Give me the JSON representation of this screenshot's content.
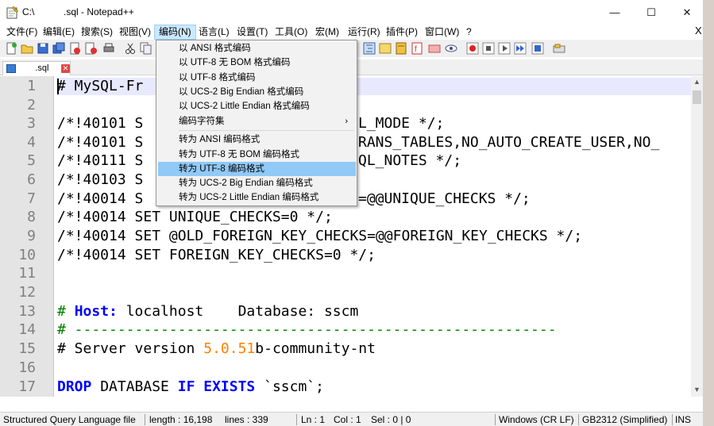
{
  "window": {
    "title": "C:\\           .sql - Notepad++",
    "minimize": "—",
    "maximize": "☐",
    "close": "✕"
  },
  "menu": {
    "items": [
      "文件(F)",
      "编辑(E)",
      "搜索(S)",
      "视图(V)",
      "编码(N)",
      "语言(L)",
      "设置(T)",
      "工具(O)",
      "宏(M)",
      "运行(R)",
      "插件(P)",
      "窗口(W)",
      "?"
    ],
    "close_doc": "X"
  },
  "tab": {
    "label": "      .sql",
    "close": "✕"
  },
  "encoding_menu": {
    "items": [
      "以 ANSI 格式编码",
      "以 UTF-8 无 BOM 格式编码",
      "以 UTF-8 格式编码",
      "以 UCS-2 Big Endian 格式编码",
      "以 UCS-2 Little Endian 格式编码",
      "编码字符集",
      "转为 ANSI 编码格式",
      "转为 UTF-8 无 BOM 编码格式",
      "转为 UTF-8 编码格式",
      "转为 UCS-2 Big Endian 编码格式",
      "转为 UCS-2 Little Endian 编码格式"
    ],
    "submenu_arrow": "›"
  },
  "editor": {
    "line_numbers": [
      "1",
      "2",
      "3",
      "4",
      "5",
      "6",
      "7",
      "8",
      "9",
      "10",
      "11",
      "12",
      "13",
      "14",
      "15",
      "16",
      "17"
    ],
    "lines": {
      "l1": "# MySQL-Fr",
      "l3": "/*!40101 S",
      "l3b": "L_MODE */;",
      "l4": "/*!40101 S",
      "l4b": "RANS_TABLES,NO_AUTO_CREATE_USER,NO_",
      "l5": "/*!40111 S",
      "l5b": "QL_NOTES */;",
      "l6": "/*!40103 S",
      "l7": "/*!40014 S",
      "l7b": "=@@UNIQUE_CHECKS */;",
      "l8": "/*!40014 SET UNIQUE_CHECKS=0 */;",
      "l9": "/*!40014 SET @OLD_FOREIGN_KEY_CHECKS=@@FOREIGN_KEY_CHECKS */;",
      "l10": "/*!40014 SET FOREIGN_KEY_CHECKS=0 */;",
      "l13_hash": "# ",
      "l13_host": "Host:",
      "l13_rest": " localhost    Database: sscm",
      "l14": "# --------------------------------------------------------",
      "l15_a": "# Server version ",
      "l15_ver": "5.0.51",
      "l15_b": "b-community-nt",
      "l17_drop": "DROP",
      "l17_db": " DATABASE ",
      "l17_if": "IF EXISTS",
      "l17_rest": " `sscm`;"
    }
  },
  "status": {
    "type": "Structured Query Language file",
    "length": "length : 16,198",
    "lines": "lines : 339",
    "ln": "Ln : 1",
    "col": "Col : 1",
    "sel": "Sel : 0 | 0",
    "eol": "Windows (CR LF)",
    "encoding": "GB2312 (Simplified)",
    "mode": "INS"
  },
  "colors": {
    "menu_highlight": "#cce8ff",
    "dropdown_highlight": "#91c9f7",
    "keyword": "#0000ff",
    "comment": "#008000",
    "number": "#ff8000",
    "current_line": "#e8e8ff"
  }
}
